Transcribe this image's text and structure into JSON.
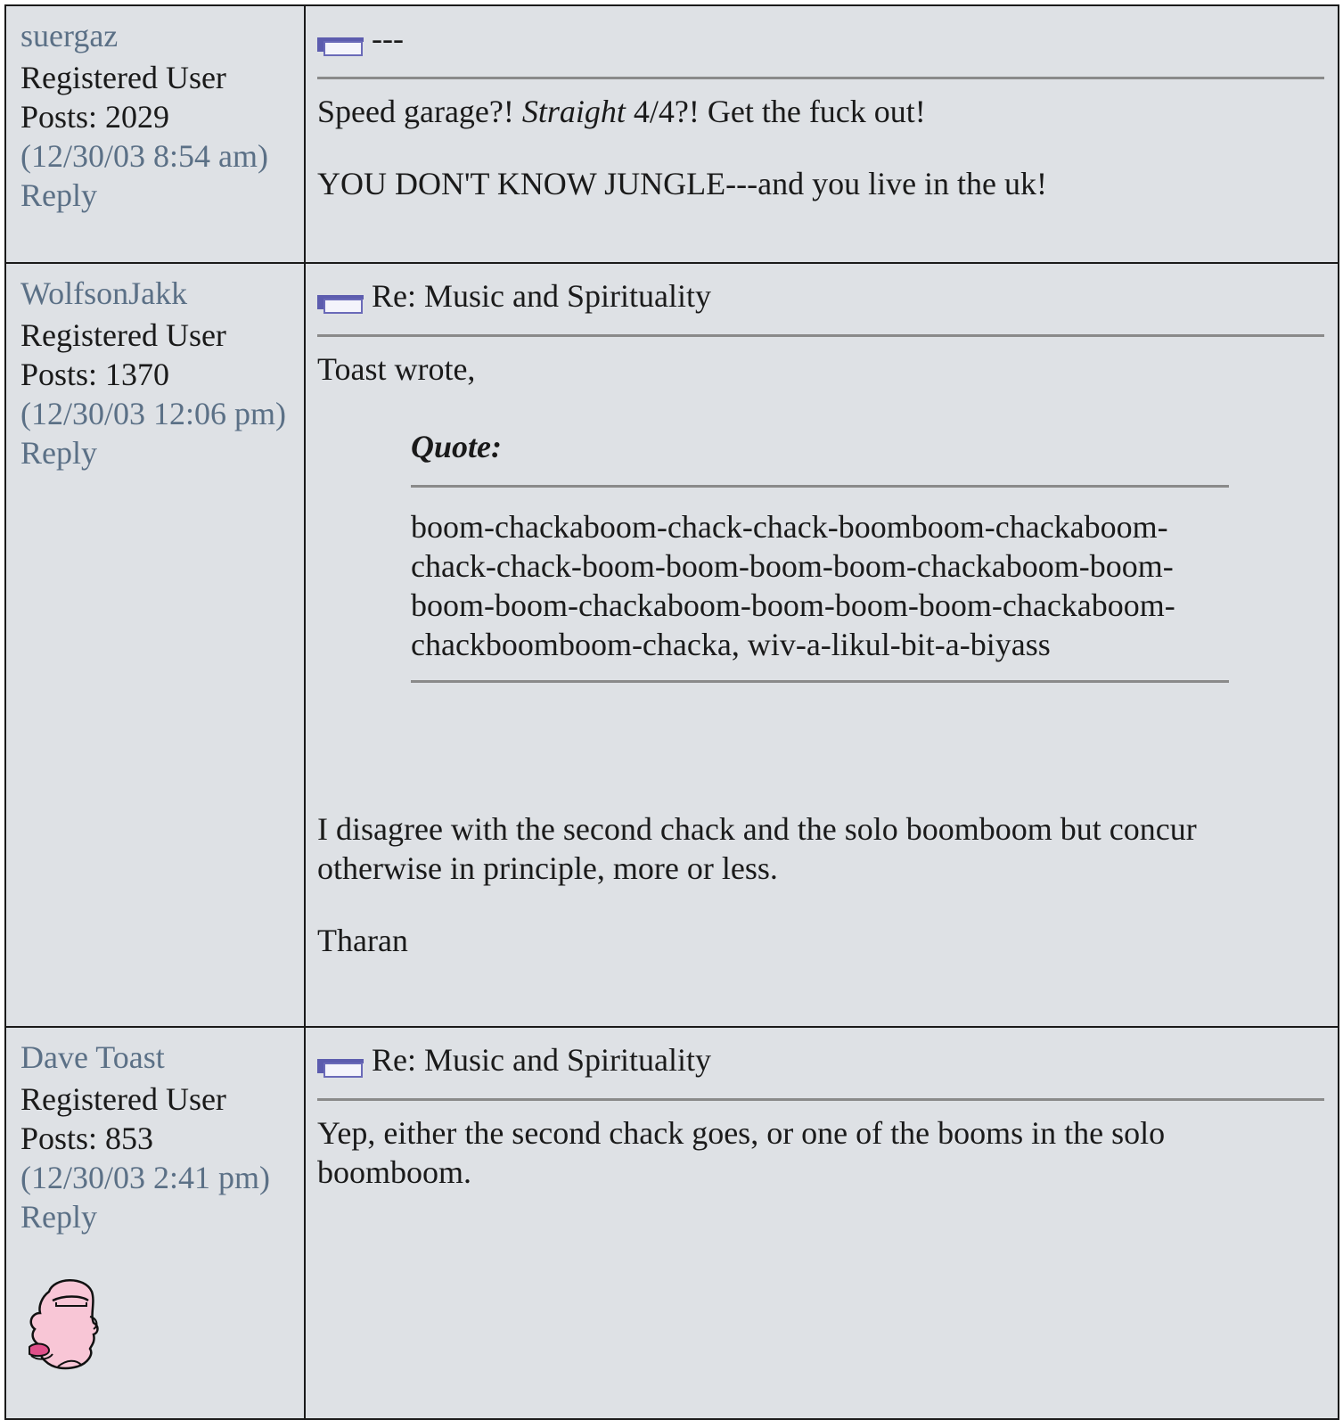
{
  "posts": [
    {
      "username": "suergaz",
      "role": "Registered User",
      "posts_count": "Posts: 2029",
      "timestamp": "(12/30/03 8:54 am)",
      "reply_label": "Reply",
      "subject": "---",
      "body": {
        "line1_a": "Speed garage?! ",
        "line1_em": "Straight",
        "line1_b": " 4/4?! Get the fuck out!",
        "line2": "YOU DON'T KNOW JUNGLE---and you live in the uk!"
      }
    },
    {
      "username": "WolfsonJakk",
      "role": "Registered User",
      "posts_count": "Posts: 1370",
      "timestamp": "(12/30/03 12:06 pm)",
      "reply_label": "Reply",
      "subject": "Re: Music and Spirituality",
      "body": {
        "intro": "Toast wrote,",
        "quote_label": "Quote:",
        "quote_text": "boom-chackaboom-chack-chack-boomboom-chackaboom-chack-chack-boom-boom-boom-boom-chackaboom-boom-boom-boom-chackaboom-boom-boom-boom-chackaboom-chackboomboom-chacka, wiv-a-likul-bit-a-biyass",
        "reply_text": "I disagree with the second chack and the solo boomboom but concur otherwise in principle, more or less.",
        "signature": "Tharan"
      }
    },
    {
      "username": "Dave Toast",
      "role": "Registered User",
      "posts_count": "Posts: 853",
      "timestamp": "(12/30/03 2:41 pm)",
      "reply_label": "Reply",
      "subject": "Re: Music and Spirituality",
      "avatar": "cartoon-face-avatar",
      "body": {
        "text": "Yep, either the second chack goes, or one of the booms in the solo boomboom."
      }
    }
  ],
  "colors": {
    "background": "#dee1e5",
    "link": "#5b7086",
    "border": "#1a1a1a",
    "separator": "#8a8a8a",
    "post_icon": "#5c5cae"
  }
}
